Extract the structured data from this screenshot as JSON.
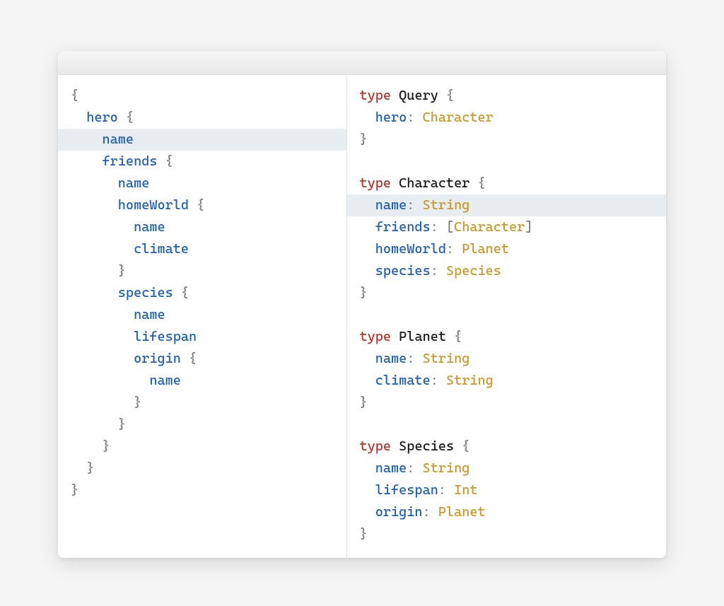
{
  "colors": {
    "punct": "#808080",
    "field": "#215fb3",
    "keyword": "#b5342b",
    "name": "#1a1a1a",
    "type": "#c79a2a",
    "highlight": "#e8edf2"
  },
  "left": {
    "lines": [
      {
        "hl": false,
        "tokens": [
          [
            "punct",
            "{"
          ]
        ]
      },
      {
        "hl": false,
        "tokens": [
          [
            "plain",
            "  "
          ],
          [
            "field",
            "hero"
          ],
          [
            "plain",
            " "
          ],
          [
            "punct",
            "{"
          ]
        ]
      },
      {
        "hl": true,
        "tokens": [
          [
            "plain",
            "    "
          ],
          [
            "field",
            "name"
          ]
        ]
      },
      {
        "hl": false,
        "tokens": [
          [
            "plain",
            "    "
          ],
          [
            "field",
            "friends"
          ],
          [
            "plain",
            " "
          ],
          [
            "punct",
            "{"
          ]
        ]
      },
      {
        "hl": false,
        "tokens": [
          [
            "plain",
            "      "
          ],
          [
            "field",
            "name"
          ]
        ]
      },
      {
        "hl": false,
        "tokens": [
          [
            "plain",
            "      "
          ],
          [
            "field",
            "homeWorld"
          ],
          [
            "plain",
            " "
          ],
          [
            "punct",
            "{"
          ]
        ]
      },
      {
        "hl": false,
        "tokens": [
          [
            "plain",
            "        "
          ],
          [
            "field",
            "name"
          ]
        ]
      },
      {
        "hl": false,
        "tokens": [
          [
            "plain",
            "        "
          ],
          [
            "field",
            "climate"
          ]
        ]
      },
      {
        "hl": false,
        "tokens": [
          [
            "plain",
            "      "
          ],
          [
            "punct",
            "}"
          ]
        ]
      },
      {
        "hl": false,
        "tokens": [
          [
            "plain",
            "      "
          ],
          [
            "field",
            "species"
          ],
          [
            "plain",
            " "
          ],
          [
            "punct",
            "{"
          ]
        ]
      },
      {
        "hl": false,
        "tokens": [
          [
            "plain",
            "        "
          ],
          [
            "field",
            "name"
          ]
        ]
      },
      {
        "hl": false,
        "tokens": [
          [
            "plain",
            "        "
          ],
          [
            "field",
            "lifespan"
          ]
        ]
      },
      {
        "hl": false,
        "tokens": [
          [
            "plain",
            "        "
          ],
          [
            "field",
            "origin"
          ],
          [
            "plain",
            " "
          ],
          [
            "punct",
            "{"
          ]
        ]
      },
      {
        "hl": false,
        "tokens": [
          [
            "plain",
            "          "
          ],
          [
            "field",
            "name"
          ]
        ]
      },
      {
        "hl": false,
        "tokens": [
          [
            "plain",
            "        "
          ],
          [
            "punct",
            "}"
          ]
        ]
      },
      {
        "hl": false,
        "tokens": [
          [
            "plain",
            "      "
          ],
          [
            "punct",
            "}"
          ]
        ]
      },
      {
        "hl": false,
        "tokens": [
          [
            "plain",
            "    "
          ],
          [
            "punct",
            "}"
          ]
        ]
      },
      {
        "hl": false,
        "tokens": [
          [
            "plain",
            "  "
          ],
          [
            "punct",
            "}"
          ]
        ]
      },
      {
        "hl": false,
        "tokens": [
          [
            "punct",
            "}"
          ]
        ]
      }
    ]
  },
  "right": {
    "lines": [
      {
        "hl": false,
        "tokens": [
          [
            "kw",
            "type"
          ],
          [
            "plain",
            " "
          ],
          [
            "name",
            "Query"
          ],
          [
            "plain",
            " "
          ],
          [
            "punct",
            "{"
          ]
        ]
      },
      {
        "hl": false,
        "tokens": [
          [
            "plain",
            "  "
          ],
          [
            "field",
            "hero"
          ],
          [
            "punct",
            ":"
          ],
          [
            "plain",
            " "
          ],
          [
            "type",
            "Character"
          ]
        ]
      },
      {
        "hl": false,
        "tokens": [
          [
            "punct",
            "}"
          ]
        ]
      },
      {
        "hl": false,
        "tokens": [
          [
            "plain",
            " "
          ]
        ]
      },
      {
        "hl": false,
        "tokens": [
          [
            "kw",
            "type"
          ],
          [
            "plain",
            " "
          ],
          [
            "name",
            "Character"
          ],
          [
            "plain",
            " "
          ],
          [
            "punct",
            "{"
          ]
        ]
      },
      {
        "hl": true,
        "tokens": [
          [
            "plain",
            "  "
          ],
          [
            "field",
            "name"
          ],
          [
            "punct",
            ":"
          ],
          [
            "plain",
            " "
          ],
          [
            "type",
            "String"
          ]
        ]
      },
      {
        "hl": false,
        "tokens": [
          [
            "plain",
            "  "
          ],
          [
            "field",
            "friends"
          ],
          [
            "punct",
            ":"
          ],
          [
            "plain",
            " "
          ],
          [
            "punct",
            "["
          ],
          [
            "type",
            "Character"
          ],
          [
            "punct",
            "]"
          ]
        ]
      },
      {
        "hl": false,
        "tokens": [
          [
            "plain",
            "  "
          ],
          [
            "field",
            "homeWorld"
          ],
          [
            "punct",
            ":"
          ],
          [
            "plain",
            " "
          ],
          [
            "type",
            "Planet"
          ]
        ]
      },
      {
        "hl": false,
        "tokens": [
          [
            "plain",
            "  "
          ],
          [
            "field",
            "species"
          ],
          [
            "punct",
            ":"
          ],
          [
            "plain",
            " "
          ],
          [
            "type",
            "Species"
          ]
        ]
      },
      {
        "hl": false,
        "tokens": [
          [
            "punct",
            "}"
          ]
        ]
      },
      {
        "hl": false,
        "tokens": [
          [
            "plain",
            " "
          ]
        ]
      },
      {
        "hl": false,
        "tokens": [
          [
            "kw",
            "type"
          ],
          [
            "plain",
            " "
          ],
          [
            "name",
            "Planet"
          ],
          [
            "plain",
            " "
          ],
          [
            "punct",
            "{"
          ]
        ]
      },
      {
        "hl": false,
        "tokens": [
          [
            "plain",
            "  "
          ],
          [
            "field",
            "name"
          ],
          [
            "punct",
            ":"
          ],
          [
            "plain",
            " "
          ],
          [
            "type",
            "String"
          ]
        ]
      },
      {
        "hl": false,
        "tokens": [
          [
            "plain",
            "  "
          ],
          [
            "field",
            "climate"
          ],
          [
            "punct",
            ":"
          ],
          [
            "plain",
            " "
          ],
          [
            "type",
            "String"
          ]
        ]
      },
      {
        "hl": false,
        "tokens": [
          [
            "punct",
            "}"
          ]
        ]
      },
      {
        "hl": false,
        "tokens": [
          [
            "plain",
            " "
          ]
        ]
      },
      {
        "hl": false,
        "tokens": [
          [
            "kw",
            "type"
          ],
          [
            "plain",
            " "
          ],
          [
            "name",
            "Species"
          ],
          [
            "plain",
            " "
          ],
          [
            "punct",
            "{"
          ]
        ]
      },
      {
        "hl": false,
        "tokens": [
          [
            "plain",
            "  "
          ],
          [
            "field",
            "name"
          ],
          [
            "punct",
            ":"
          ],
          [
            "plain",
            " "
          ],
          [
            "type",
            "String"
          ]
        ]
      },
      {
        "hl": false,
        "tokens": [
          [
            "plain",
            "  "
          ],
          [
            "field",
            "lifespan"
          ],
          [
            "punct",
            ":"
          ],
          [
            "plain",
            " "
          ],
          [
            "type",
            "Int"
          ]
        ]
      },
      {
        "hl": false,
        "tokens": [
          [
            "plain",
            "  "
          ],
          [
            "field",
            "origin"
          ],
          [
            "punct",
            ":"
          ],
          [
            "plain",
            " "
          ],
          [
            "type",
            "Planet"
          ]
        ]
      },
      {
        "hl": false,
        "tokens": [
          [
            "punct",
            "}"
          ]
        ]
      }
    ]
  }
}
